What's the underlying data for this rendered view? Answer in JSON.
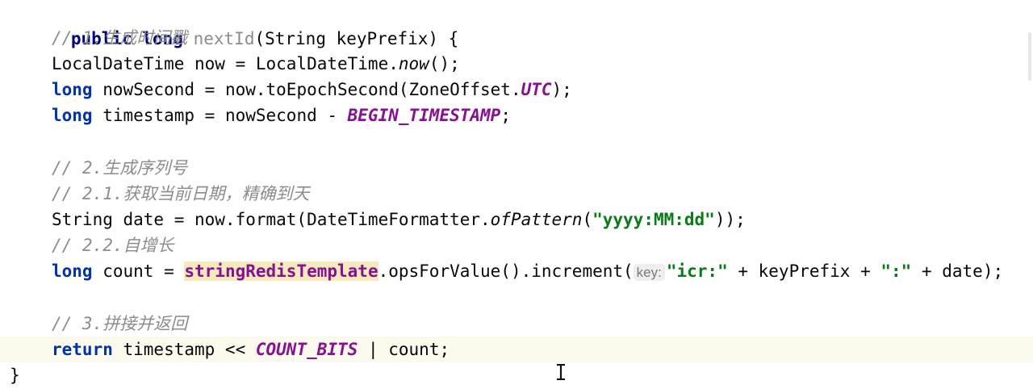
{
  "lines": [
    {
      "parts": [
        "public",
        " ",
        "long",
        " ",
        "nextId",
        "(String keyPrefix) {"
      ]
    },
    {
      "comment": "// 1.生成时间戳"
    },
    {
      "parts": [
        "LocalDateTime now = LocalDateTime.",
        "now",
        "();"
      ]
    },
    {
      "parts": [
        "long",
        " nowSecond = now.toEpochSecond(ZoneOffset.",
        "UTC",
        ");"
      ]
    },
    {
      "parts": [
        "long",
        " timestamp = nowSecond - ",
        "BEGIN_TIMESTAMP",
        ";"
      ]
    },
    {
      "comment": "// 2.生成序列号"
    },
    {
      "comment": "// 2.1.获取当前日期，精确到天"
    },
    {
      "parts": [
        "String date = now.format(DateTimeFormatter.",
        "ofPattern",
        "(",
        "\"yyyy:MM:dd\"",
        "));"
      ]
    },
    {
      "comment": "// 2.2.自增长"
    },
    {
      "parts": [
        "long",
        " count = ",
        "stringRedisTemplate",
        ".opsForValue().increment(",
        "key:",
        "\"icr:\"",
        " + keyPrefix + ",
        "\":\"",
        " + date);"
      ]
    },
    {
      "comment": "// 3.拼接并返回"
    },
    {
      "parts": [
        "return",
        " timestamp << ",
        "COUNT_BITS",
        " | count;"
      ]
    },
    {
      "parts": [
        "}"
      ]
    }
  ],
  "icons": {
    "text_cursor": "i-beam-cursor-icon"
  },
  "colors": {
    "keyword": "#0033b3",
    "comment": "#8c8c8c",
    "static_field": "#871094",
    "string": "#067d17",
    "current_line": "#fcfaed",
    "field_highlight": "#f5eabb"
  }
}
